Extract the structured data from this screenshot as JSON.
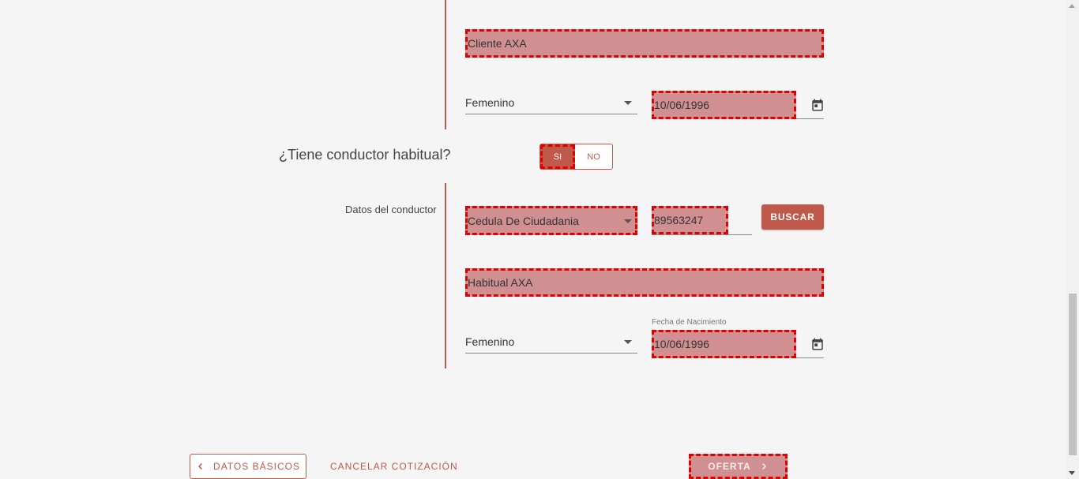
{
  "owner_block": {
    "name_value": "Cliente AXA",
    "gender_value": "Femenino",
    "birthdate_value": "10/06/1996"
  },
  "habitual_question": {
    "label": "¿Tiene conductor habitual?",
    "yes_label": "SI",
    "no_label": "NO",
    "selected": "SI"
  },
  "driver_block": {
    "section_label": "Datos del conductor",
    "doc_type_value": "Cedula De Ciudadania",
    "doc_number_value": "89563247",
    "search_button": "BUSCAR",
    "name_value": "Habitual AXA",
    "gender_value": "Femenino",
    "birthdate_label": "Fecha de Nacimiento",
    "birthdate_value": "10/06/1996"
  },
  "footer": {
    "back_button": "DATOS BÁSICOS",
    "cancel_button": "CANCELAR COTIZACIÓN",
    "next_button": "OFERTA"
  },
  "colors": {
    "accent": "#c0594a",
    "highlight_fill": "#d09091",
    "highlight_border": "#e00000"
  },
  "icons": [
    "calendar-icon",
    "chevron-left-icon",
    "chevron-right-icon",
    "dropdown-caret-icon"
  ]
}
